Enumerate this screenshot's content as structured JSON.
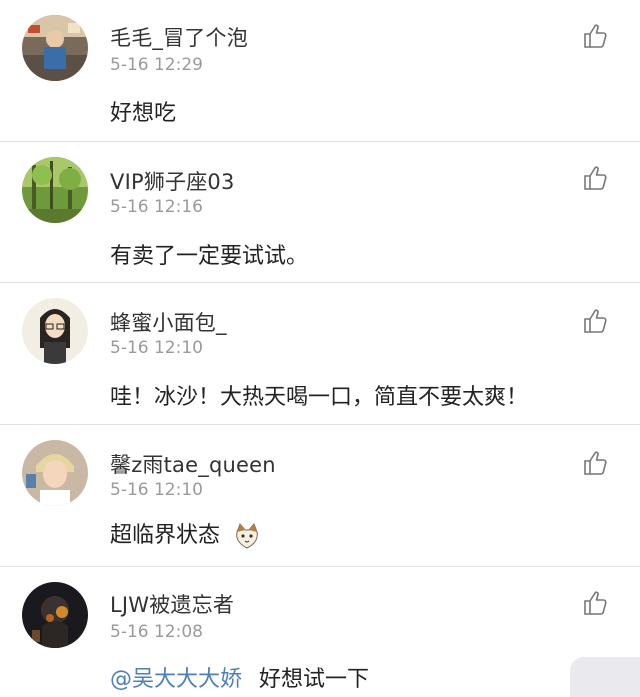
{
  "comments": [
    {
      "username": "毛毛_冒了个泡",
      "time": "5-16 12:29",
      "text": "好想吃",
      "avatar_icon": "user-avatar-icon"
    },
    {
      "username": "VIP狮子座03",
      "time": "5-16 12:16",
      "text": "有卖了一定要试试。",
      "avatar_icon": "forest-avatar-icon"
    },
    {
      "username": "蜂蜜小面包_",
      "time": "5-16 12:10",
      "text": "哇！冰沙！大热天喝一口，简直不要太爽！",
      "avatar_icon": "girl-avatar-icon"
    },
    {
      "username": "馨z雨tae_queen",
      "time": "5-16 12:10",
      "text": "超临界状态",
      "emoji": "cat-emoji-icon",
      "avatar_icon": "boy-avatar-icon"
    },
    {
      "username": "LJW被遗忘者",
      "time": "5-16 12:08",
      "mention": "@吴大大大娇",
      "text": "好想试一下",
      "avatar_icon": "dark-avatar-icon"
    }
  ],
  "colors": {
    "mention": "#4d7fb8",
    "timestamp": "#9a9a9a",
    "divider": "#e2e2e2"
  }
}
